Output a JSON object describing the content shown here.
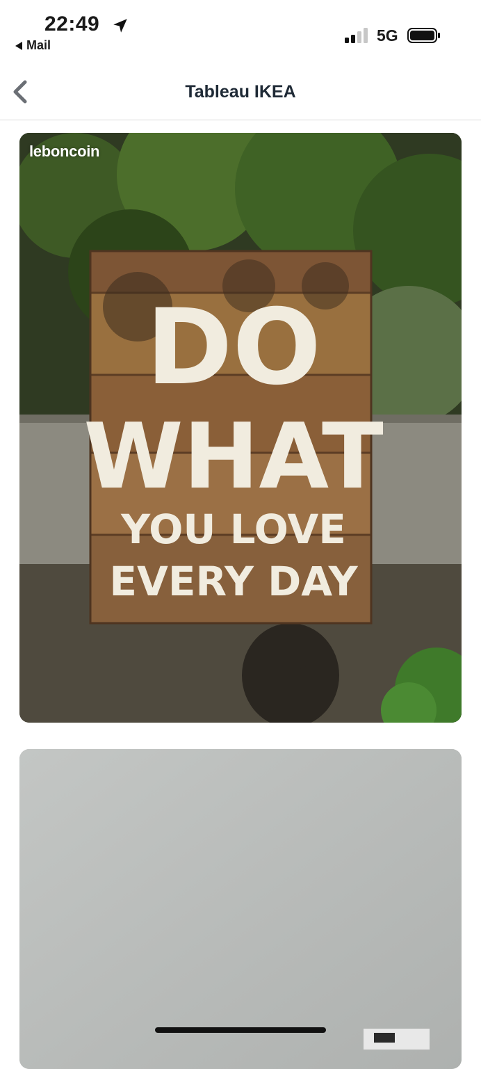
{
  "status_bar": {
    "time": "22:49",
    "back_app": "Mail",
    "network": "5G",
    "signal_bars_active": 2,
    "signal_bars_total": 4
  },
  "nav": {
    "title": "Tableau IKEA",
    "back_icon": "chevron-left-icon"
  },
  "listing": {
    "watermark": "leboncoin",
    "sign_lines": [
      "DO",
      "WHAT",
      "YOU LOVE",
      "EVERY DAY"
    ]
  },
  "colors": {
    "title": "#1f2a36",
    "divider": "#d9d9d9"
  }
}
